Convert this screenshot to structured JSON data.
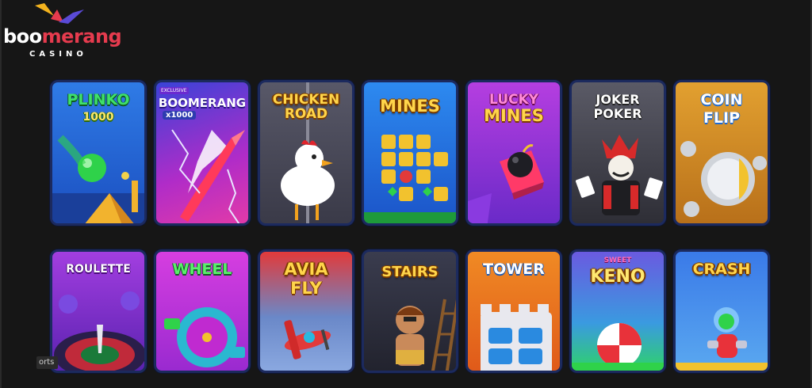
{
  "brand": {
    "word_start": "boo",
    "word_accent": "merang",
    "subtitle": "CASINO"
  },
  "colors": {
    "background": "#161616",
    "brand_red": "#e63b4e",
    "title_gold": "#ffd54a"
  },
  "games": [
    {
      "title": "PLINKO",
      "sub": "1000",
      "icon": "green-ball-icon",
      "bg": "#2d6fd8"
    },
    {
      "title": "BOOMERANG",
      "sub": "x1000",
      "badge": "EXCLUSIVE",
      "icon": "boomerang-icon",
      "bg": "#8a2bd6"
    },
    {
      "title": "CHICKEN",
      "sub": "ROAD",
      "icon": "chicken-icon",
      "bg": "#4b4b5a"
    },
    {
      "title": "MINES",
      "sub": "",
      "icon": "mines-grid-icon",
      "bg": "#1f6fd8"
    },
    {
      "title": "LUCKY",
      "sub": "MINES",
      "icon": "bomb-icon",
      "bg": "#9a2fd6"
    },
    {
      "title": "JOKER",
      "sub": "POKER",
      "icon": "joker-icon",
      "bg": "#3a3a42"
    },
    {
      "title": "COIN",
      "sub": "FLIP",
      "icon": "coin-icon",
      "bg": "#d88c1e"
    },
    {
      "title": "ROULETTE",
      "sub": "",
      "icon": "roulette-wheel-icon",
      "bg": "#8a2bd6"
    },
    {
      "title": "WHEEL",
      "sub": "",
      "icon": "wheel-icon",
      "bg": "#c23bd8"
    },
    {
      "title": "AVIA",
      "sub": "FLY",
      "icon": "plane-icon",
      "bg": "#d8323a"
    },
    {
      "title": "STAIRS",
      "sub": "",
      "icon": "caveman-icon",
      "bg": "#2f3140"
    },
    {
      "title": "TOWER",
      "sub": "",
      "icon": "tower-icon",
      "bg": "#e8741e"
    },
    {
      "title": "KENO",
      "sub": "SWEET",
      "icon": "candy-icon",
      "bg": "#7a49d8"
    },
    {
      "title": "CRASH",
      "sub": "",
      "icon": "rocket-icon",
      "bg": "#3b7fe0"
    }
  ],
  "footer_chip": "orts"
}
